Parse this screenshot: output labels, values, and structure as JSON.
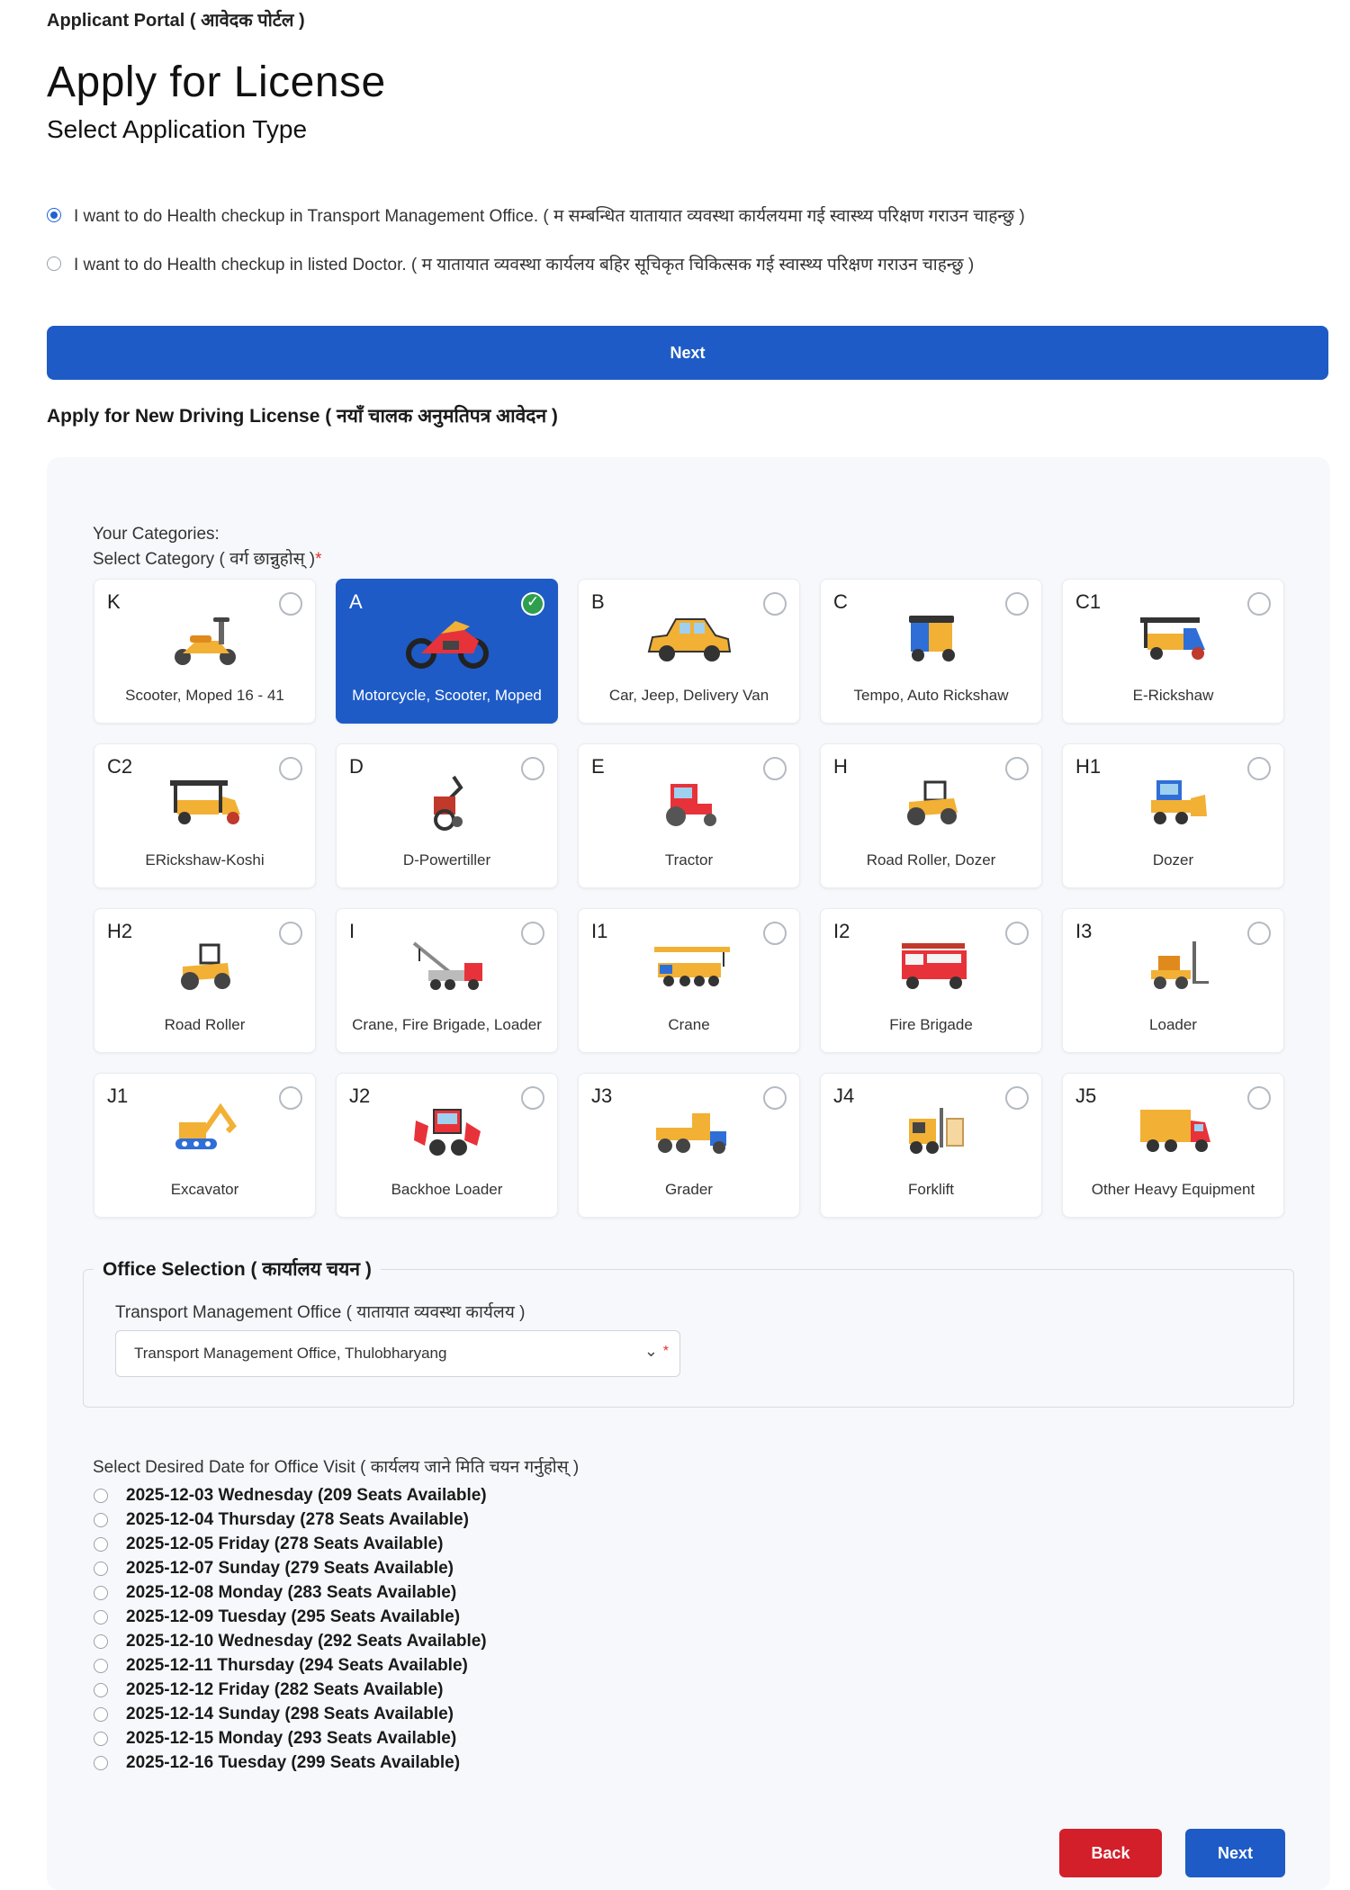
{
  "header": {
    "portal": "Applicant Portal ( आवेदक पोर्टल )",
    "title": "Apply for License",
    "subtitle": "Select Application Type"
  },
  "application_types": [
    {
      "label": "I want to do Health checkup in Transport Management Office. ( म सम्बन्धित यातायात व्यवस्था कार्यलयमा गई स्वास्थ्य परिक्षण गराउन चाहन्छु )",
      "checked": true
    },
    {
      "label": "I want to do Health checkup in listed Doctor. ( म यातायात व्यवस्था कार्यलय बहिर सूचिकृत चिकित्सक गई स्वास्थ्य परिक्षण गराउन चाहन्छु )",
      "checked": false
    }
  ],
  "next_top_label": "Next",
  "section_title": "Apply for New Driving License ( नयाँ चालक अनुमतिपत्र आवेदन )",
  "categories_block": {
    "your_categories": "Your Categories:",
    "select_category": "Select Category ( वर्ग छान्नुहोस् )",
    "required_mark": "*"
  },
  "categories": [
    {
      "code": "K",
      "label": "Scooter, Moped 16 - 41",
      "icon": "scooter-icon",
      "selected": false
    },
    {
      "code": "A",
      "label": "Motorcycle, Scooter, Moped",
      "icon": "motorcycle-icon",
      "selected": true
    },
    {
      "code": "B",
      "label": "Car, Jeep, Delivery Van",
      "icon": "car-icon",
      "selected": false
    },
    {
      "code": "C",
      "label": "Tempo, Auto Rickshaw",
      "icon": "auto-rickshaw-icon",
      "selected": false
    },
    {
      "code": "C1",
      "label": "E-Rickshaw",
      "icon": "e-rickshaw-icon",
      "selected": false
    },
    {
      "code": "C2",
      "label": "ERickshaw-Koshi",
      "icon": "e-rickshaw-koshi-icon",
      "selected": false
    },
    {
      "code": "D",
      "label": "D-Powertiller",
      "icon": "powertiller-icon",
      "selected": false
    },
    {
      "code": "E",
      "label": "Tractor",
      "icon": "tractor-icon",
      "selected": false
    },
    {
      "code": "H",
      "label": "Road Roller, Dozer",
      "icon": "road-roller-dozer-icon",
      "selected": false
    },
    {
      "code": "H1",
      "label": "Dozer",
      "icon": "dozer-icon",
      "selected": false
    },
    {
      "code": "H2",
      "label": "Road Roller",
      "icon": "road-roller-icon",
      "selected": false
    },
    {
      "code": "I",
      "label": "Crane, Fire Brigade, Loader",
      "icon": "tow-crane-icon",
      "selected": false
    },
    {
      "code": "I1",
      "label": "Crane",
      "icon": "crane-icon",
      "selected": false
    },
    {
      "code": "I2",
      "label": "Fire Brigade",
      "icon": "fire-truck-icon",
      "selected": false
    },
    {
      "code": "I3",
      "label": "Loader",
      "icon": "loader-icon",
      "selected": false
    },
    {
      "code": "J1",
      "label": "Excavator",
      "icon": "excavator-icon",
      "selected": false
    },
    {
      "code": "J2",
      "label": "Backhoe Loader",
      "icon": "backhoe-loader-icon",
      "selected": false
    },
    {
      "code": "J3",
      "label": "Grader",
      "icon": "grader-icon",
      "selected": false
    },
    {
      "code": "J4",
      "label": "Forklift",
      "icon": "forklift-icon",
      "selected": false
    },
    {
      "code": "J5",
      "label": "Other Heavy Equipment",
      "icon": "heavy-truck-icon",
      "selected": false
    }
  ],
  "office": {
    "legend": "Office Selection ( कार्यालय चयन )",
    "label": "Transport Management Office ( यातायात व्यवस्था कार्यलय )",
    "selected": "Transport Management Office, Thulobharyang",
    "required_mark": "*"
  },
  "dates": {
    "caption": "Select Desired Date for Office Visit ( कार्यलय जाने मिति चयन गर्नुहोस् )",
    "options": [
      "2025-12-03 Wednesday (209 Seats Available)",
      "2025-12-04 Thursday (278 Seats Available)",
      "2025-12-05 Friday (278 Seats Available)",
      "2025-12-07 Sunday (279 Seats Available)",
      "2025-12-08 Monday (283 Seats Available)",
      "2025-12-09 Tuesday (295 Seats Available)",
      "2025-12-10 Wednesday (292 Seats Available)",
      "2025-12-11 Thursday (294 Seats Available)",
      "2025-12-12 Friday (282 Seats Available)",
      "2025-12-14 Sunday (298 Seats Available)",
      "2025-12-15 Monday (293 Seats Available)",
      "2025-12-16 Tuesday (299 Seats Available)"
    ]
  },
  "buttons": {
    "back": "Back",
    "next": "Next"
  },
  "colors": {
    "primary": "#1e5bc6",
    "danger": "#d21f2a",
    "check": "#2e9e4f",
    "panel": "#f6f8fb"
  }
}
